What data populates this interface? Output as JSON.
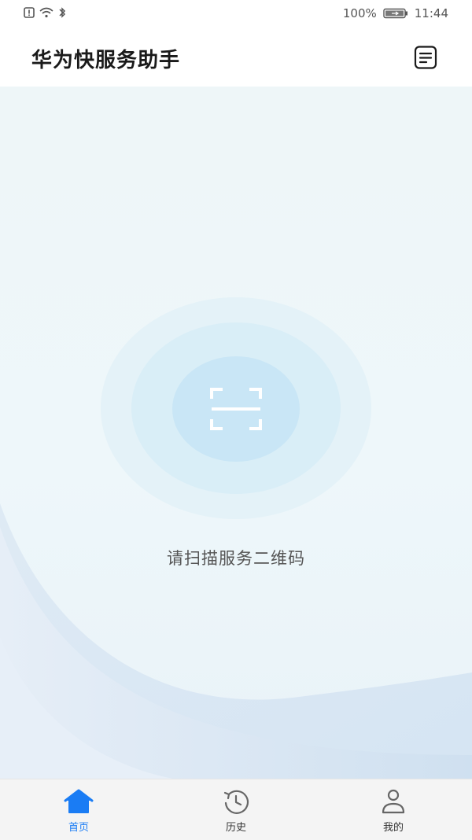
{
  "status_bar": {
    "battery": "100%",
    "time": "11:44"
  },
  "header": {
    "title": "华为快服务助手",
    "record_icon": "document-list-icon"
  },
  "main": {
    "scan_icon": "scan-frame-icon",
    "scan_prompt": "请扫描服务二维码"
  },
  "tabs": [
    {
      "label": "首页",
      "icon": "home-icon",
      "active": true
    },
    {
      "label": "历史",
      "icon": "history-clock-icon",
      "active": false
    },
    {
      "label": "我的",
      "icon": "person-icon",
      "active": false
    }
  ],
  "colors": {
    "accent": "#1a7cf4",
    "scan_inner": "#c9e6f6",
    "scan_middle": "#d9eef7",
    "scan_outer": "#e4f2f8"
  }
}
